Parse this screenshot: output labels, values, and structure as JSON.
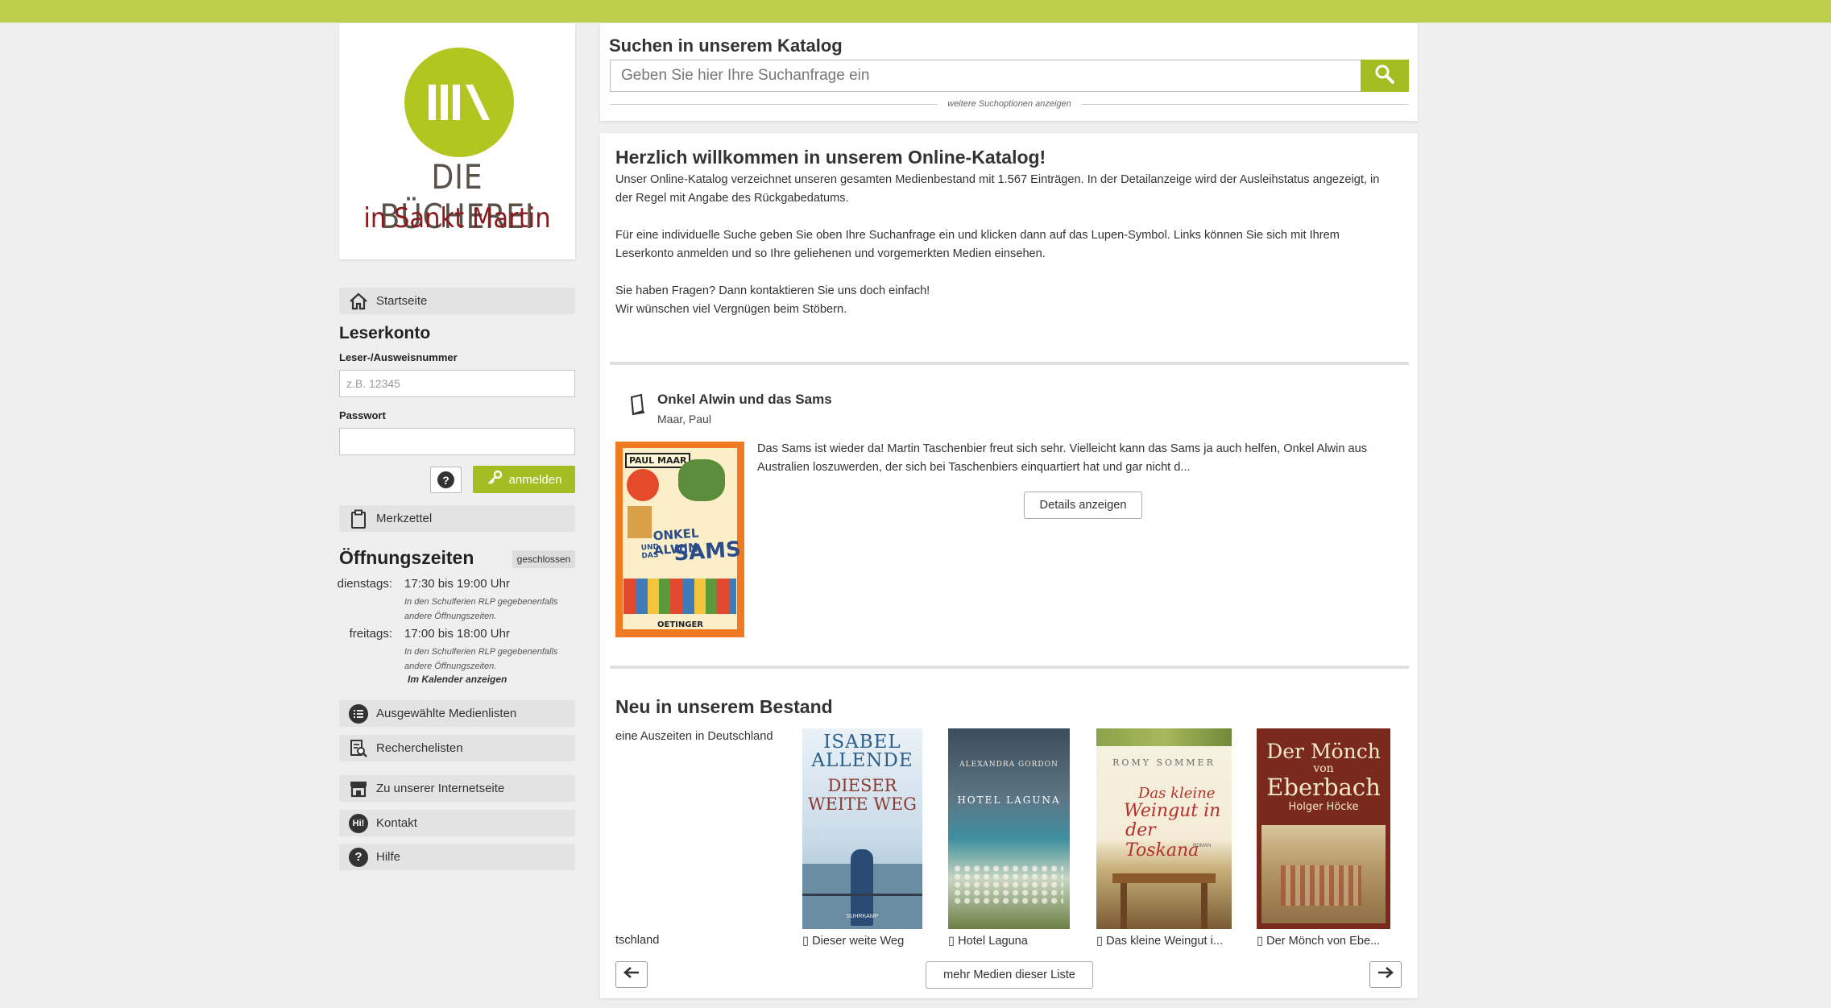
{
  "logo": {
    "line1": "DIE BÜCHEREI",
    "line2": "in Sankt Martin"
  },
  "nav": {
    "home": "Startseite",
    "merkzettel": "Merkzettel",
    "medienlisten": "Ausgewählte Medienlisten",
    "recherchelisten": "Recherchelisten",
    "internetseite": "Zu unserer Internetseite",
    "kontakt": "Kontakt",
    "hilfe": "Hilfe"
  },
  "login": {
    "title": "Leserkonto",
    "id_label": "Leser-/Ausweisnummer",
    "id_placeholder": "z.B. 12345",
    "pw_label": "Passwort",
    "help": "?",
    "submit": "anmelden"
  },
  "hours": {
    "title": "Öffnungszeiten",
    "status": "geschlossen",
    "days": [
      {
        "day": "dienstags:",
        "time": "17:30 bis 19:00 Uhr",
        "note": "In den Schulferien RLP gegebenenfalls andere Öffnungszeiten."
      },
      {
        "day": "freitags:",
        "time": "17:00 bis 18:00 Uhr",
        "note": "In den Schulferien RLP gegebenenfalls andere Öffnungszeiten."
      }
    ],
    "calendar_link": "Im Kalender anzeigen"
  },
  "search": {
    "title": "Suchen in unserem Katalog",
    "placeholder": "Geben Sie hier Ihre Suchanfrage ein",
    "more_options": "weitere Suchoptionen anzeigen"
  },
  "welcome": {
    "title": "Herzlich willkommen in unserem Online-Katalog!",
    "p1": "Unser Online-Katalog verzeichnet unseren gesamten Medienbestand mit 1.567 Einträgen. In der Detailanzeige wird der Ausleihstatus angezeigt, in der Regel mit Angabe des Rückgabedatums.",
    "p2": "Für eine individuelle Suche geben Sie oben Ihre Suchanfrage ein und klicken dann auf das Lupen-Symbol. Links können Sie sich mit Ihrem Leserkonto anmelden und so Ihre geliehenen und vorgemerkten Medien einsehen.",
    "p3a": "Sie haben Fragen? Dann kontaktieren Sie uns doch einfach!",
    "p3b": "Wir wünschen viel Vergnügen beim Stöbern."
  },
  "featured": {
    "title": "Onkel Alwin und das Sams",
    "author": "Maar, Paul",
    "description": "Das Sams ist wieder da! Martin Taschenbier freut sich sehr. Vielleicht kann das Sams ja auch helfen, Onkel Alwin aus Australien loszuwerden, der sich bei Taschenbiers einquartiert hat und gar nicht d...",
    "details_button": "Details anzeigen",
    "cover": {
      "author": "PAUL MAAR",
      "title_a": "ONKEL ALWIN",
      "title_b": "UND DAS",
      "title_c": "SAMS",
      "publisher": "OETINGER"
    }
  },
  "new_items": {
    "title": "Neu in unserem Bestand",
    "partial_top": "eine Auszeiten in Deutschland",
    "partial_caption": "tschland",
    "items": [
      {
        "caption": "Dieser weite Weg",
        "cover_author": "ISABEL ALLENDE",
        "cover_title": "DIESER WEITE WEG",
        "cover_publisher": "SUHRKAMP"
      },
      {
        "caption": "Hotel Laguna",
        "cover_author": "ALEXANDRA GORDON",
        "cover_title": "HOTEL LAGUNA"
      },
      {
        "caption": "Das kleine Weingut i...",
        "cover_author": "ROMY SOMMER",
        "cover_title_1": "Das kleine",
        "cover_title_2": "Weingut in",
        "cover_title_3": "der Toskana",
        "cover_genre": "ROMAN"
      },
      {
        "caption": "Der Mönch von Ebe...",
        "cover_title_1": "Der Mönch",
        "cover_title_2": "von",
        "cover_title_3": "Eberbach",
        "cover_author": "Holger Höcke"
      }
    ],
    "more_button": "mehr Medien dieser Liste"
  },
  "colors": {
    "accent": "#a4bd22",
    "topbar": "#bccf4a",
    "logo_green": "#b3c521",
    "logo_red": "#8a1a1e"
  }
}
